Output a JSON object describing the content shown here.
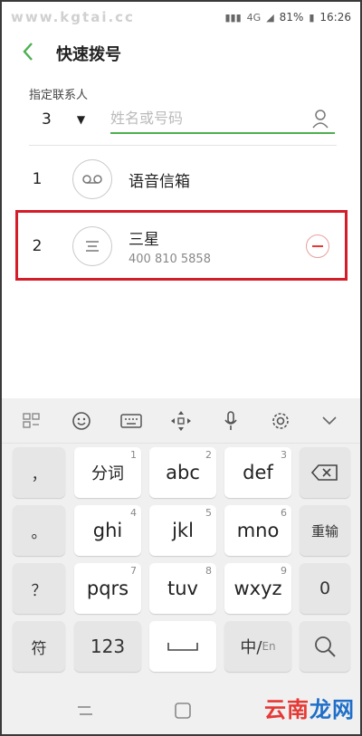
{
  "status_bar": {
    "watermark": "www.kgtai.cc",
    "signal_text": "4G",
    "battery": "81%",
    "time": "16:26"
  },
  "app_bar": {
    "title": "快速拨号"
  },
  "assign": {
    "label": "指定联系人",
    "selected_number": "3",
    "search_placeholder": "姓名或号码",
    "search_value": ""
  },
  "speed_dial": [
    {
      "index": "1",
      "name": "语音信箱",
      "number": "",
      "icon": "voicemail-icon"
    },
    {
      "index": "2",
      "name": "三星",
      "number": "400 810 5858",
      "icon": "contact-card-icon"
    }
  ],
  "keyboard": {
    "toolbar_icons": [
      "grid-icon",
      "emoji-icon",
      "keyboard-icon",
      "move-icon",
      "mic-icon",
      "settings-icon",
      "collapse-icon"
    ],
    "keys": {
      "comma": "，",
      "period": "。",
      "question": "？",
      "symbol": "符",
      "k1": "分词",
      "k1_n": "1",
      "k2": "abc",
      "k2_n": "2",
      "k3": "def",
      "k3_n": "3",
      "k4": "ghi",
      "k4_n": "4",
      "k5": "jkl",
      "k5_n": "5",
      "k6": "mno",
      "k6_n": "6",
      "k7": "pqrs",
      "k7_n": "7",
      "k8": "tuv",
      "k8_n": "8",
      "k9": "wxyz",
      "k9_n": "9",
      "num": "123",
      "zh_en_a": "中/",
      "zh_en_b": "En",
      "retype": "重输",
      "zero": "0"
    }
  },
  "brand": {
    "part1": "云南",
    "part2": "龙网"
  },
  "colors": {
    "accent_green": "#4caf50",
    "highlight_red": "#d51c29",
    "remove_red": "#e53935"
  }
}
